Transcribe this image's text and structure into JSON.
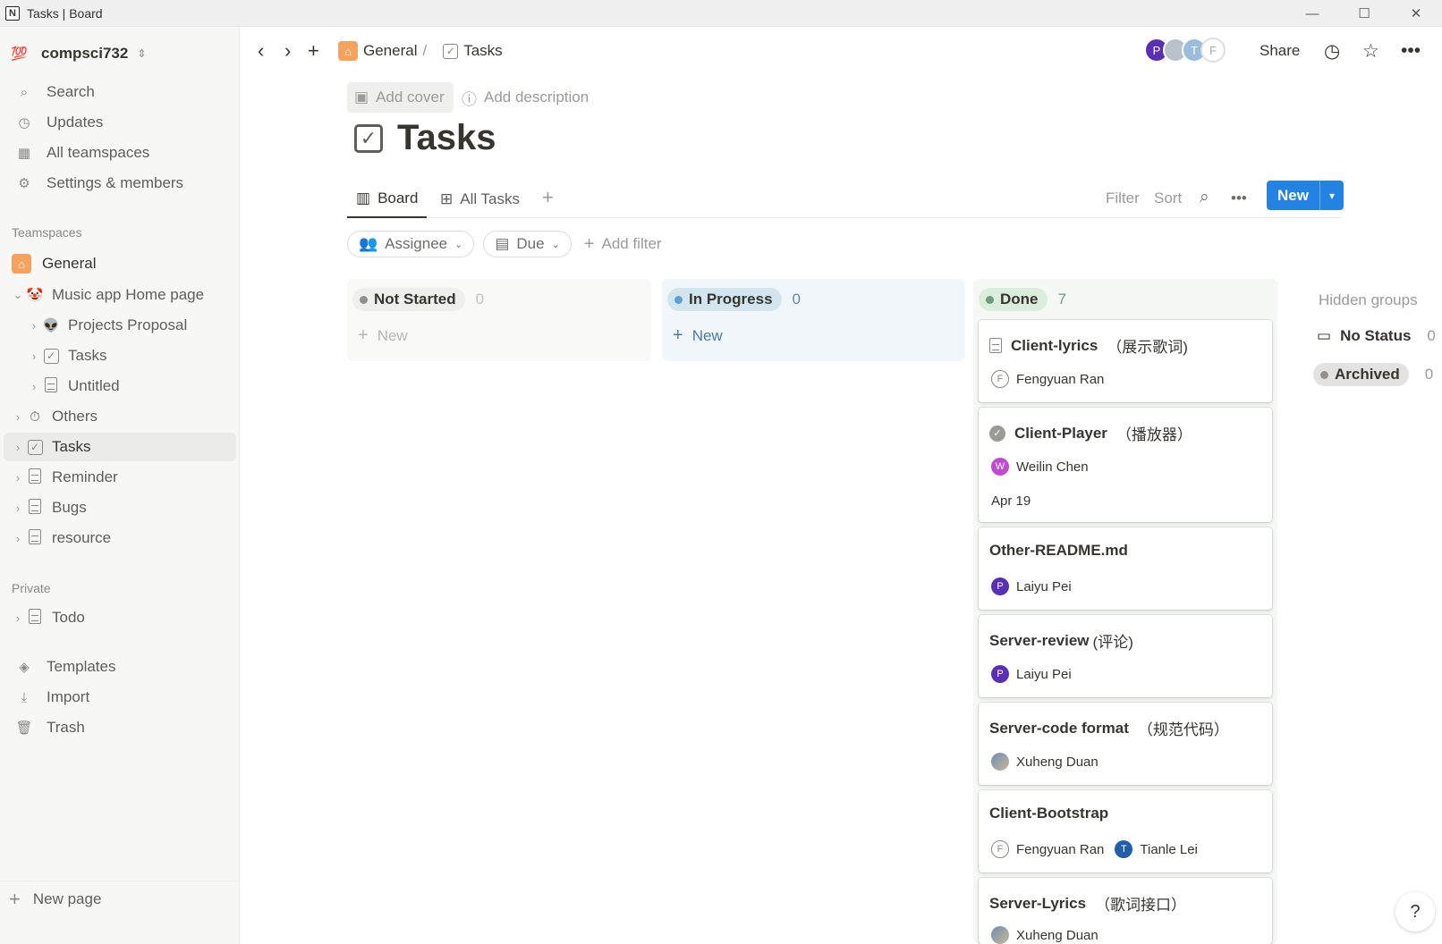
{
  "window": {
    "title": "Tasks | Board",
    "app_icon": "N"
  },
  "sidebar": {
    "workspace": {
      "emoji": "💯",
      "name": "compsci732"
    },
    "top_items": [
      {
        "icon": "search-icon",
        "glyph": "🔍",
        "label": "Search"
      },
      {
        "icon": "clock-icon",
        "glyph": "🕘",
        "label": "Updates"
      },
      {
        "icon": "building-icon",
        "glyph": "▦",
        "label": "All teamspaces"
      },
      {
        "icon": "gear-icon",
        "glyph": "⚙",
        "label": "Settings & members"
      }
    ],
    "teamspaces_label": "Teamspaces",
    "teamspace_tree": [
      {
        "label": "General"
      },
      {
        "label": "Music app Home page",
        "emoji": "🤡"
      },
      {
        "label": "Projects Proposal",
        "emoji": "👽"
      },
      {
        "label": "Tasks"
      },
      {
        "label": "Untitled"
      },
      {
        "label": "Others",
        "emoji": "⏱"
      },
      {
        "label": "Tasks"
      },
      {
        "label": "Reminder"
      },
      {
        "label": "Bugs"
      },
      {
        "label": "resource"
      }
    ],
    "private_label": "Private",
    "private_tree": [
      {
        "label": "Todo"
      }
    ],
    "bottom_items": [
      {
        "label": "Templates"
      },
      {
        "label": "Import"
      },
      {
        "label": "Trash"
      }
    ],
    "new_page": "New page"
  },
  "topbar": {
    "breadcrumb": [
      {
        "label": "General"
      },
      {
        "separator": "/"
      },
      {
        "label": "Tasks"
      }
    ],
    "avatars": [
      {
        "letter": "P",
        "color": "#5b2fb5"
      },
      {
        "letter": "",
        "color": "#b9c2cc"
      },
      {
        "letter": "T",
        "color": "#9bbcdb"
      },
      {
        "letter": "F",
        "color": "#ffffff"
      }
    ],
    "share": "Share"
  },
  "page": {
    "add_cover": "Add cover",
    "add_description": "Add description",
    "title": "Tasks",
    "tabs": [
      {
        "label": "Board"
      },
      {
        "label": "All Tasks"
      }
    ],
    "view_tools": {
      "filter": "Filter",
      "sort": "Sort",
      "more": "•••",
      "new": "New"
    },
    "filters": [
      {
        "label": "Assignee"
      },
      {
        "label": "Due"
      }
    ],
    "add_filter": "Add filter"
  },
  "board": {
    "columns": [
      {
        "name": "Not Started",
        "count": "0",
        "new_label": "New",
        "dot": "#91918e",
        "pill_bg": "#efefed",
        "bg": "#f9f9f8",
        "count_color": "#c3c2bf",
        "new_color": "#b8b7b4"
      },
      {
        "name": "In Progress",
        "count": "0",
        "new_label": "New",
        "dot": "#5e9fd8",
        "pill_bg": "#d3e5ef",
        "bg": "#f1f6fa",
        "count_color": "#5e87b0",
        "new_color": "#4a7aa8"
      },
      {
        "name": "Done",
        "count": "7",
        "dot": "#6c9b7d",
        "pill_bg": "#dbeddb",
        "bg": "#f5f8f4",
        "count_color": "#6c9b7d"
      }
    ],
    "cards": [
      {
        "title": "Client-lyrics",
        "title_zh": "（展示歌词)",
        "people": [
          {
            "initial": "F",
            "name": "Fengyuan Ran"
          }
        ]
      },
      {
        "title": "Client-Player",
        "title_zh": "（播放器）",
        "people": [
          {
            "initial": "W",
            "name": "Weilin Chen"
          }
        ],
        "due": "Apr 19"
      },
      {
        "title": "Other-README.md",
        "people": [
          {
            "initial": "P",
            "name": "Laiyu Pei"
          }
        ]
      },
      {
        "title": "Server-review",
        "title_zh": "(评论)",
        "people": [
          {
            "initial": "P",
            "name": "Laiyu Pei"
          }
        ]
      },
      {
        "title": "Server-code format",
        "title_zh": "（规范代码）",
        "people": [
          {
            "initial": "",
            "name": "Xuheng Duan"
          }
        ]
      },
      {
        "title": "Client-Bootstrap",
        "people": [
          {
            "initial": "F",
            "name": "Fengyuan Ran"
          },
          {
            "initial": "T",
            "name": "Tianle Lei"
          }
        ]
      },
      {
        "title": "Server-Lyrics",
        "title_zh": "（歌词接口）",
        "people": [
          {
            "initial": "",
            "name": "Xuheng Duan"
          }
        ]
      }
    ],
    "hidden_groups_label": "Hidden groups",
    "hidden_groups": [
      {
        "name": "No Status",
        "count": "0"
      },
      {
        "name": "Archived",
        "count": "0"
      }
    ]
  },
  "help": "?"
}
